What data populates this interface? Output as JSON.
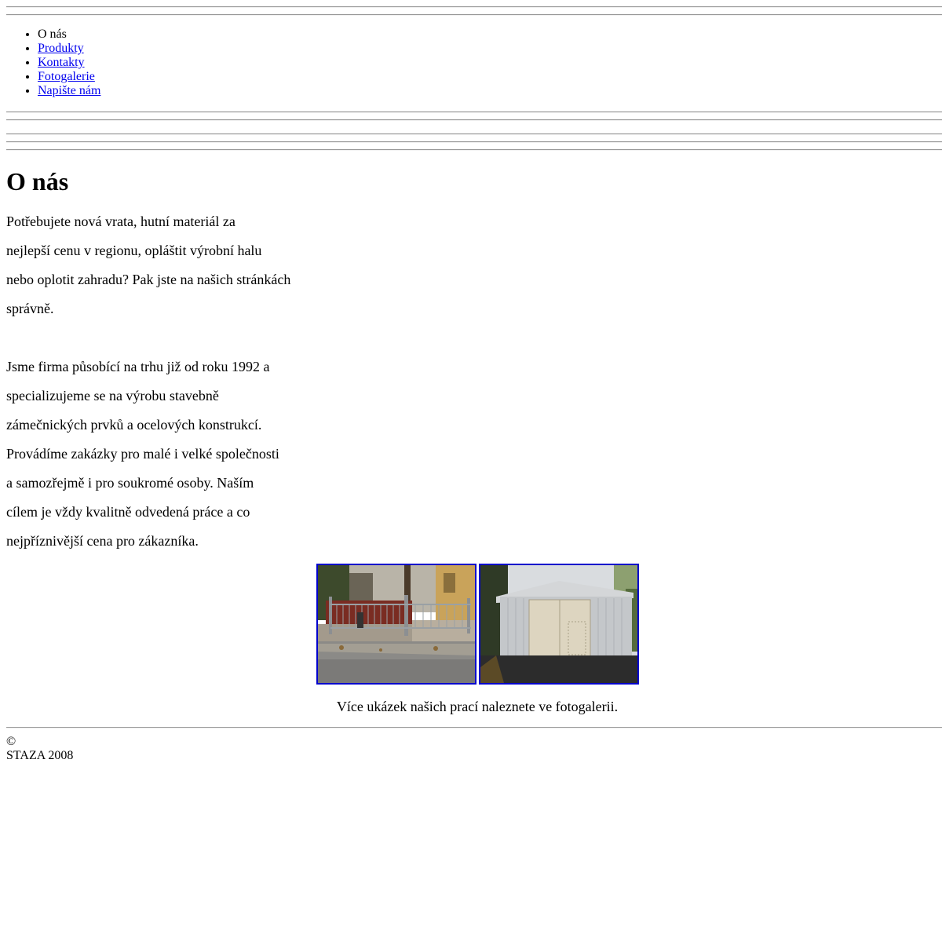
{
  "nav": {
    "items": [
      {
        "label": "O nás",
        "current": true
      },
      {
        "label": "Produkty",
        "current": false
      },
      {
        "label": "Kontakty",
        "current": false
      },
      {
        "label": "Fotogalerie",
        "current": false
      },
      {
        "label": "Napište nám",
        "current": false
      }
    ]
  },
  "main": {
    "title": "O nás",
    "paragraph1": [
      "Potřebujete nová vrata, hutní materiál za",
      "nejlepší cenu v regionu, opláštit výrobní halu",
      "nebo oplotit zahradu? Pak jste na našich stránkách",
      "správně."
    ],
    "paragraph2": [
      "Jsme firma působící na trhu již od roku 1992 a",
      "specializujeme se na výrobu stavebně",
      "zámečnických prvků a ocelových konstrukcí.",
      "Provádíme zakázky pro malé i velké společnosti",
      "a samozřejmě i pro soukromé osoby. Naším",
      "cílem je vždy kvalitně odvedená práce a co",
      "nejpříznivější cena pro zákazníka."
    ],
    "gallery": {
      "images": [
        {
          "icon": "fence-photo-icon"
        },
        {
          "icon": "garage-photo-icon"
        }
      ],
      "note": "Více ukázek našich prací naleznete ve fotogalerii."
    }
  },
  "footer": {
    "copyright_symbol": "©",
    "text": "STAZA 2008"
  },
  "colors": {
    "link": "#0000ee",
    "thumb_border": "#0000cc",
    "rule": "#9a9a9a"
  }
}
